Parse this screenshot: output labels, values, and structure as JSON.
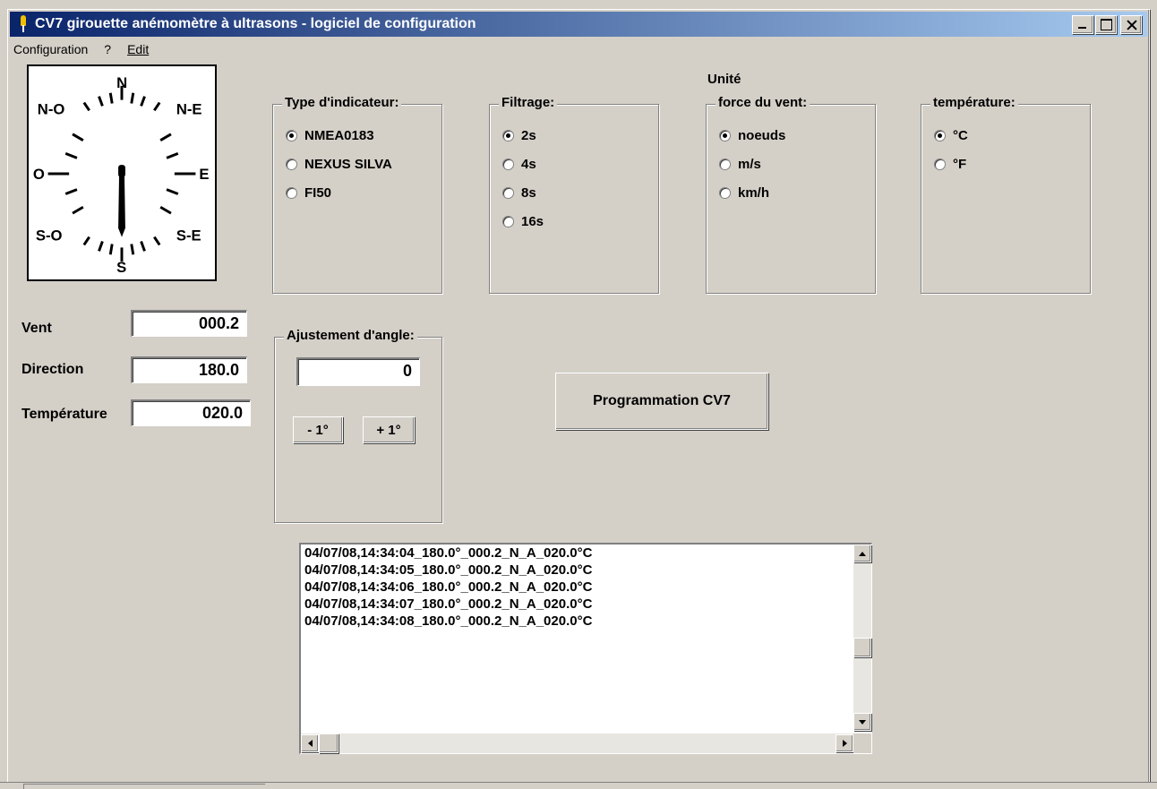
{
  "window": {
    "title": "CV7 girouette anémomètre à ultrasons - logiciel de configuration"
  },
  "menu": {
    "configuration": "Configuration",
    "help": "?",
    "edit": "Edit"
  },
  "compass": {
    "labels": {
      "n": "N",
      "ne": "N-E",
      "e": "E",
      "se": "S-E",
      "s": "S",
      "so": "S-O",
      "o": "O",
      "no": "N-O"
    },
    "direction_deg": 180.0
  },
  "readouts": {
    "vent_label": "Vent",
    "vent_value": "000.2",
    "direction_label": "Direction",
    "direction_value": "180.0",
    "temperature_label": "Température",
    "temperature_value": "020.0"
  },
  "indicator": {
    "title": "Type d'indicateur:",
    "options": [
      "NMEA0183",
      "NEXUS SILVA",
      "FI50"
    ],
    "selected": 0
  },
  "filtering": {
    "title": "Filtrage:",
    "options": [
      "2s",
      "4s",
      "8s",
      "16s"
    ],
    "selected": 0
  },
  "unit": {
    "heading": "Unité",
    "wind": {
      "title": "force du vent:",
      "options": [
        "noeuds",
        "m/s",
        "km/h"
      ],
      "selected": 0
    },
    "temperature": {
      "title": "température:",
      "options": [
        "°C",
        "°F"
      ],
      "selected": 0
    }
  },
  "angle": {
    "title": "Ajustement d'angle:",
    "value": "0",
    "minus_label": "- 1°",
    "plus_label": "+ 1°"
  },
  "program_button": "Programmation CV7",
  "log": {
    "lines": [
      "04/07/08,14:34:04_180.0°_000.2_N_A_020.0°C",
      "04/07/08,14:34:05_180.0°_000.2_N_A_020.0°C",
      "04/07/08,14:34:06_180.0°_000.2_N_A_020.0°C",
      "04/07/08,14:34:07_180.0°_000.2_N_A_020.0°C",
      "04/07/08,14:34:08_180.0°_000.2_N_A_020.0°C"
    ]
  }
}
